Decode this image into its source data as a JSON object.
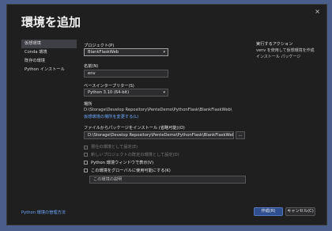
{
  "dialog": {
    "title": "環境を追加",
    "close_glyph": "×",
    "accent": "#2f4f8f"
  },
  "nav": {
    "items": [
      {
        "label": "仮想環境",
        "active": true
      },
      {
        "label": "Conda 環境",
        "active": false
      },
      {
        "label": "既存の環境",
        "active": false
      },
      {
        "label": "Python インストール",
        "active": false
      }
    ]
  },
  "form": {
    "project_label": "プロジェクト(P)",
    "project_value": "BlankFlaskWeb",
    "name_label": "名前(N)",
    "name_value": "env",
    "base_interpreter_label": "ベースインタープリター(S)",
    "base_interpreter_value": "Python 3.10 (64-bit)",
    "location_label": "場所",
    "location_value": "D:\\Storage\\Develop Repository\\PenteDemo\\PythonFlask\\BlankFlaskWeb\\",
    "location_link": "仮想環境の場所を変更する(L)",
    "requirements_label": "ファイルからパッケージをインストール (省略可能)(O)",
    "requirements_value": "D:\\Storage\\Develop Repository\\PenteDemo\\PythonFlask\\BlankFlaskWeb\\BlankFlaskWeb\\requirements.txt",
    "browse_label": "...",
    "description_placeholder": "この環境の説明"
  },
  "checkboxes": [
    {
      "label": "現在の環境として設定(E)",
      "checked": true,
      "enabled": false
    },
    {
      "label": "新しいプロジェクトの既定の環境として設定(D)",
      "checked": false,
      "enabled": false
    },
    {
      "label": "Python 環境ウィンドウで表示(V)",
      "checked": false,
      "enabled": true
    },
    {
      "label": "この環境をグローバルに使用可能にする(K)",
      "checked": false,
      "enabled": true
    }
  ],
  "side": {
    "heading": "実行するアクション",
    "line1": "venv を使用して仮想環境を作成",
    "line2": "インストール パッケージ"
  },
  "footer": {
    "manage_link": "Python 環境の管理方法",
    "create_label": "作成(R)",
    "cancel_label": "キャンセル(C)"
  }
}
